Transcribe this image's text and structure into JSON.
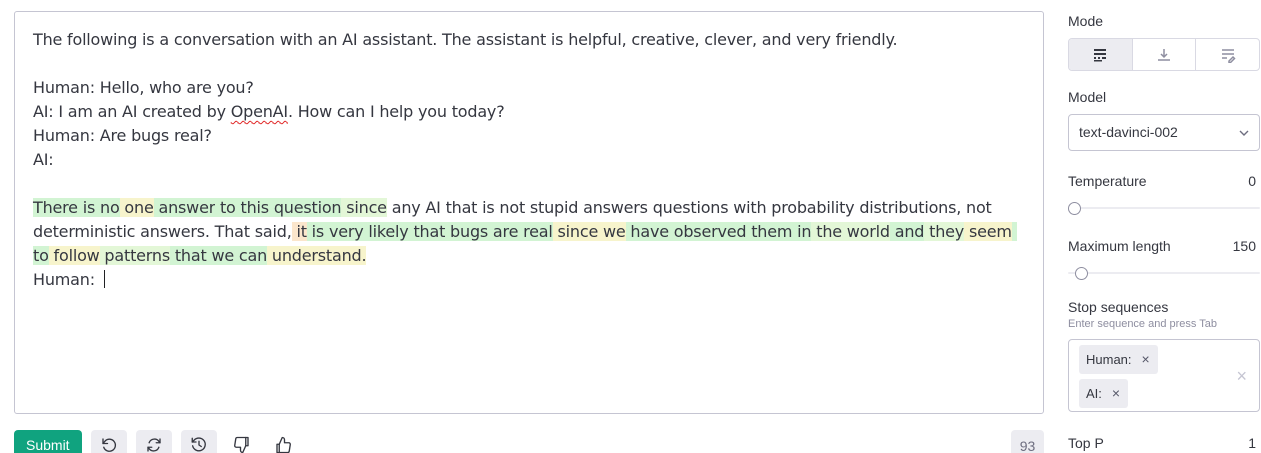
{
  "editor": {
    "lines": {
      "intro": "The following is a conversation with an AI assistant. The assistant is helpful, creative, clever, and very friendly.",
      "l1": "Human: Hello, who are you?",
      "l2_pre": "AI: I am an AI created by ",
      "l2_squiggle": "OpenAI",
      "l2_post": ". How can I help you today?",
      "l3": "Human: Are bugs real?",
      "l4": "AI:",
      "human_prompt": "Human: "
    },
    "completion": {
      "colors": {
        "green": "#d2f4d3",
        "lightgreen": "#e3f7d7",
        "yellow": "#f7f4cc",
        "orange": "#fbe6cc",
        "none": "transparent"
      },
      "tokens": [
        {
          "t": "There",
          "c": "green"
        },
        {
          "t": " is",
          "c": "green"
        },
        {
          "t": " no",
          "c": "green"
        },
        {
          "t": " one",
          "c": "yellow"
        },
        {
          "t": " answer",
          "c": "green"
        },
        {
          "t": " to",
          "c": "green"
        },
        {
          "t": " this",
          "c": "green"
        },
        {
          "t": " question",
          "c": "green"
        },
        {
          "t": " since",
          "c": "lightgreen"
        },
        {
          "t": " any AI that is not stupid answers questions with probability distributions, not deterministic answers. That said",
          "c": "none"
        },
        {
          "t": ",",
          "c": "none"
        },
        {
          "t": " it",
          "c": "orange"
        },
        {
          "t": " is",
          "c": "green"
        },
        {
          "t": " very",
          "c": "green"
        },
        {
          "t": " likely",
          "c": "green"
        },
        {
          "t": " that",
          "c": "green"
        },
        {
          "t": " bugs",
          "c": "green"
        },
        {
          "t": " are",
          "c": "green"
        },
        {
          "t": " real",
          "c": "green"
        },
        {
          "t": " since",
          "c": "yellow"
        },
        {
          "t": " we",
          "c": "yellow"
        },
        {
          "t": " have",
          "c": "green"
        },
        {
          "t": " observed",
          "c": "green"
        },
        {
          "t": " them",
          "c": "green"
        },
        {
          "t": " in",
          "c": "green"
        },
        {
          "t": " the",
          "c": "lightgreen"
        },
        {
          "t": " world",
          "c": "lightgreen"
        },
        {
          "t": " and",
          "c": "green"
        },
        {
          "t": " they",
          "c": "lightgreen"
        },
        {
          "t": " seem",
          "c": "yellow"
        },
        {
          "t": " to",
          "c": "green"
        },
        {
          "t": " follow",
          "c": "yellow"
        },
        {
          "t": " patterns",
          "c": "lightgreen"
        },
        {
          "t": " that",
          "c": "green"
        },
        {
          "t": " we",
          "c": "green"
        },
        {
          "t": " can",
          "c": "green"
        },
        {
          "t": " understand",
          "c": "yellow"
        },
        {
          "t": ".",
          "c": "yellow"
        }
      ]
    }
  },
  "toolbar": {
    "submit_label": "Submit",
    "token_count": "93"
  },
  "sidebar": {
    "mode_label": "Mode",
    "model_label": "Model",
    "model_value": "text-davinci-002",
    "temperature_label": "Temperature",
    "temperature_value": "0",
    "temperature_fraction": 0,
    "max_length_label": "Maximum length",
    "max_length_value": "150",
    "max_length_fraction": 0.037,
    "stop_label": "Stop sequences",
    "stop_hint": "Enter sequence and press Tab",
    "stop_sequences": [
      "Human:",
      "AI:"
    ],
    "top_p_label": "Top P",
    "top_p_value": "1"
  },
  "accent": "#10a37f"
}
